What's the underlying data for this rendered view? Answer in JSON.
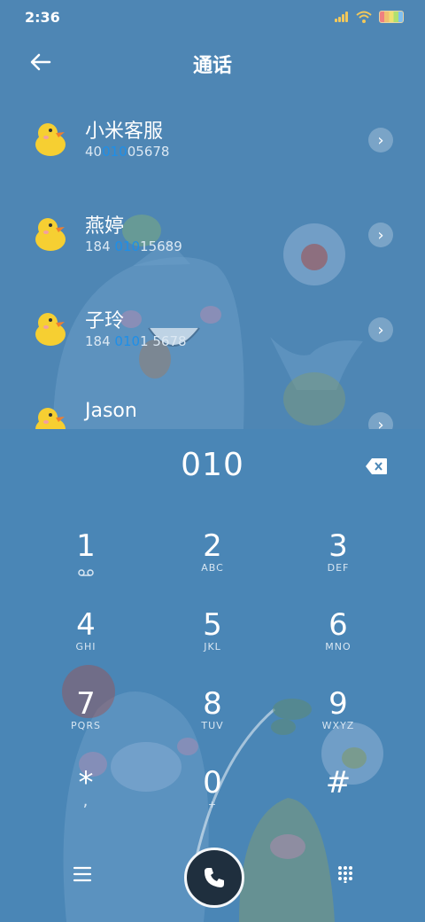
{
  "status": {
    "time": "2:36"
  },
  "header": {
    "title": "通话"
  },
  "contacts": [
    {
      "name": "小米客服",
      "num_pre": "40",
      "num_hl": "010",
      "num_post": "05678"
    },
    {
      "name": "燕婷",
      "num_pre": "184 ",
      "num_hl": "010",
      "num_post": "15689"
    },
    {
      "name": "子玲",
      "num_pre": "184 ",
      "num_hl": "010",
      "num_post": "1 5678"
    },
    {
      "name": "Jason",
      "num_pre": "",
      "num_hl": "",
      "num_post": ""
    }
  ],
  "dialer": {
    "input": "010",
    "keys": [
      {
        "digit": "1",
        "letters": ""
      },
      {
        "digit": "2",
        "letters": "ABC"
      },
      {
        "digit": "3",
        "letters": "DEF"
      },
      {
        "digit": "4",
        "letters": "GHI"
      },
      {
        "digit": "5",
        "letters": "JKL"
      },
      {
        "digit": "6",
        "letters": "MNO"
      },
      {
        "digit": "7",
        "letters": "PQRS"
      },
      {
        "digit": "8",
        "letters": "TUV"
      },
      {
        "digit": "9",
        "letters": "WXYZ"
      },
      {
        "digit": "*",
        "letters": ","
      },
      {
        "digit": "0",
        "letters": "+"
      },
      {
        "digit": "#",
        "letters": ""
      }
    ]
  },
  "icons": [
    "back-arrow-icon",
    "signal-icon",
    "wifi-icon",
    "battery-icon",
    "duck-avatar-icon",
    "chevron-right-icon",
    "backspace-icon",
    "voicemail-icon",
    "menu-icon",
    "phone-icon",
    "keypad-icon"
  ]
}
